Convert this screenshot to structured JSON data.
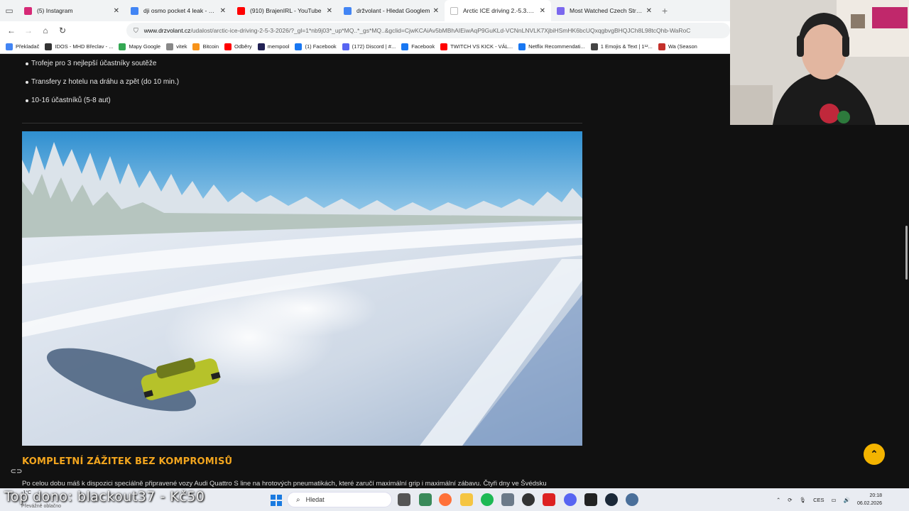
{
  "browser": {
    "tabs": [
      {
        "title": "(5) Instagram",
        "color": "#d62976",
        "active": false
      },
      {
        "title": "dji osmo pocket 4 leak - Hledat",
        "color": "#4285f4",
        "active": false
      },
      {
        "title": "(910) BrajenIRL - YouTube",
        "color": "#ff0000",
        "active": false
      },
      {
        "title": "držvolant - Hledat Googlem",
        "color": "#4285f4",
        "active": false
      },
      {
        "title": "Arctic ICE driving 2.-5.3.2026 | D",
        "color": "#ffffff",
        "active": true
      },
      {
        "title": "Most Watched Czech Streamers",
        "color": "#7b68ee",
        "active": false
      }
    ],
    "url_domain": "www.drzvolant.cz",
    "url_path": "/udalost/arctic-ice-driving-2-5-3-2026/?_gl=1*nb9j03*_up*MQ..*_gs*MQ..&gclid=CjwKCAiAv5bMBhAIEiwAqP9GuKLd-VCNnLNVLK7XjbiHSmHK6bcUQxqgbvgBHQJCh8L98tcQhb-WaRoC",
    "bookmarks": [
      {
        "label": "Překladač",
        "color": "#4285f4"
      },
      {
        "label": "IDOS - MHD Břeclav - ...",
        "color": "#333333"
      },
      {
        "label": "Mapy Google",
        "color": "#34a853"
      },
      {
        "label": "vitek",
        "color": "#888888"
      },
      {
        "label": "Bitcoin",
        "color": "#f7931a"
      },
      {
        "label": "Odběry",
        "color": "#ff0000"
      },
      {
        "label": "mempool",
        "color": "#222255"
      },
      {
        "label": "(1) Facebook",
        "color": "#1877f2"
      },
      {
        "label": "(172) Discord | #...",
        "color": "#5865f2"
      },
      {
        "label": "Facebook",
        "color": "#1877f2"
      },
      {
        "label": "TWITCH VS KICK - VÁL...",
        "color": "#ff0000"
      },
      {
        "label": "Netflix Recommendati...",
        "color": "#1877f2"
      },
      {
        "label": "1 Emojis & Text | 1¹²...",
        "color": "#444444"
      },
      {
        "label": "Wa (Season",
        "color": "#c4302b"
      }
    ]
  },
  "page": {
    "bullets": [
      "Trofeje pro 3 nejlepší účastníky soutěže",
      "Transfery z hotelu na dráhu a zpět (do 10 min.)",
      "10-16 účastníků (5-8 aut)"
    ],
    "heading": "KOMPLETNÍ ZÁŽITEK BEZ KOMPROMISŮ",
    "paragraph": "Po celou dobu máš k dispozici speciálně připravené vozy Audi Quattro S line na hrotových pneumatikách, které zaručí maximální grip i maximální zábavu. Čtyři dny ve Švédsku",
    "scroll_top_icon": "chevron-up-icon",
    "accent": "#f2a51e"
  },
  "overlay": {
    "donation": "Top dono: blackout37 - Kč50"
  },
  "taskbar": {
    "weather_temp": "-1°C",
    "weather_cond": "Převážně oblačno",
    "search_placeholder": "Hledat",
    "language": "CES",
    "time": "20:18",
    "date": "06.02.2026"
  }
}
